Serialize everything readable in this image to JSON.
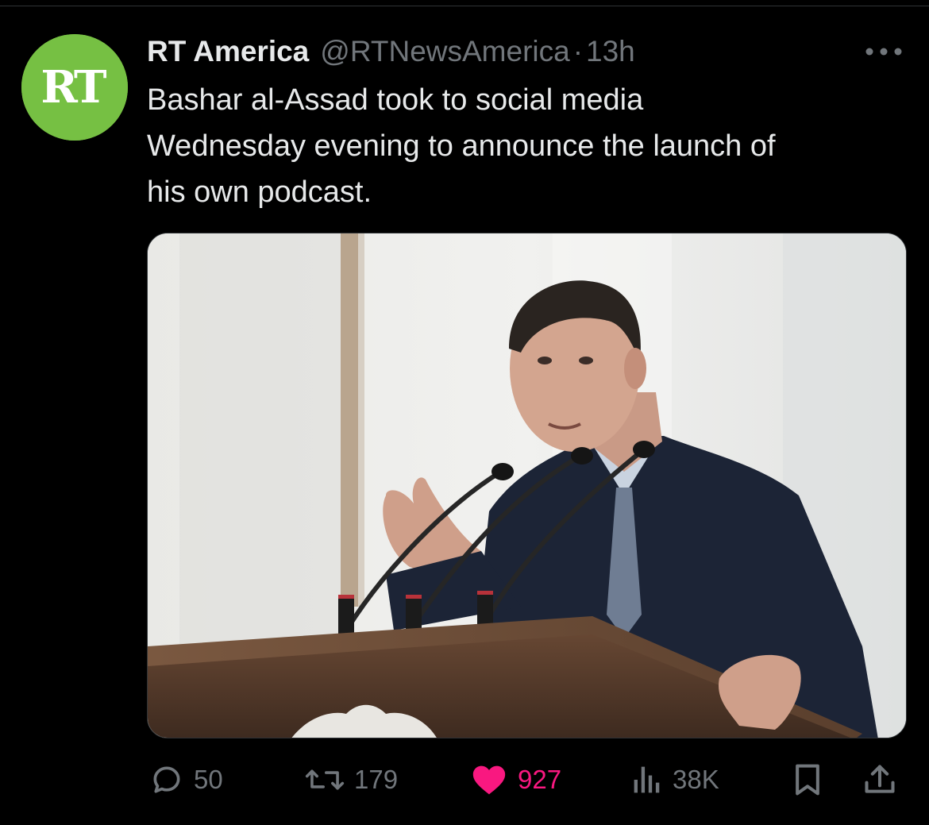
{
  "tweet": {
    "author": {
      "display_name": "RT America",
      "handle": "@RTNewsAmerica",
      "avatar_text": "RT",
      "avatar_color": "#76c043"
    },
    "separator": "·",
    "time": "13h",
    "text": "Bashar al-Assad took to social media\nWednesday evening to announce the launch of\nhis own podcast.",
    "more_icon": "more-horizontal-icon",
    "media": {
      "kind": "photo"
    },
    "actions": {
      "reply": {
        "icon": "reply-icon",
        "count": "50"
      },
      "retweet": {
        "icon": "retweet-icon",
        "count": "179"
      },
      "like": {
        "icon": "heart-filled-icon",
        "count": "927",
        "liked": true,
        "color": "#f91880"
      },
      "views": {
        "icon": "views-chart-icon",
        "count": "38K"
      },
      "bookmark": {
        "icon": "bookmark-icon"
      },
      "share": {
        "icon": "share-icon"
      }
    }
  },
  "colors": {
    "background": "#000000",
    "text_primary": "#e7e9ea",
    "text_secondary": "#71767b",
    "like_pink": "#f91880",
    "divider": "#2f3336"
  }
}
